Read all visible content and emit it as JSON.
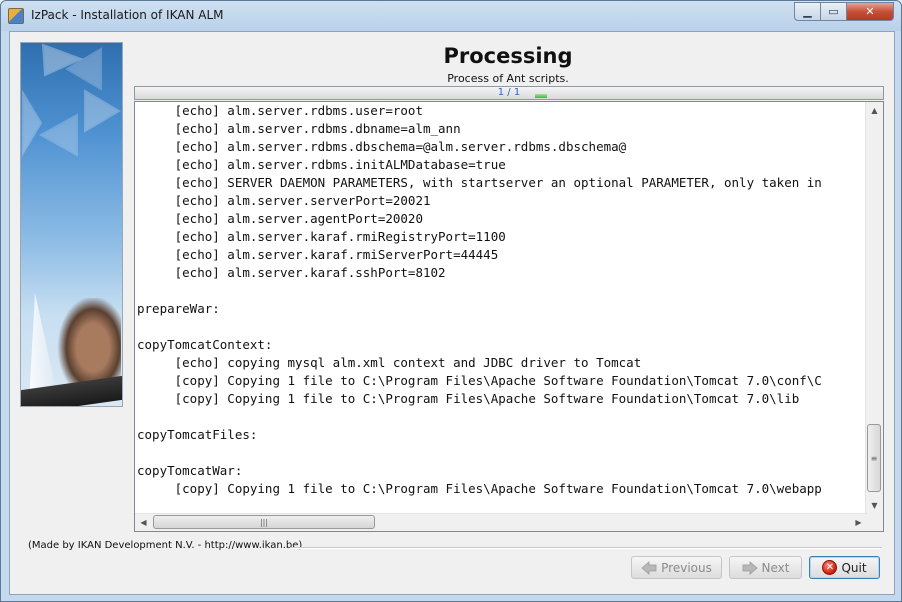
{
  "window": {
    "title": "IzPack - Installation of IKAN ALM",
    "min_glyph": "▁",
    "max_glyph": "▭",
    "close_glyph": "✕"
  },
  "header": {
    "title": "Processing",
    "subtitle": "Process of Ant scripts."
  },
  "progress": {
    "label": "1 / 1",
    "fraction": 1.0
  },
  "log": {
    "lines": [
      "     [echo] alm.server.rdbms.user=root",
      "     [echo] alm.server.rdbms.dbname=alm_ann",
      "     [echo] alm.server.rdbms.dbschema=@alm.server.rdbms.dbschema@",
      "     [echo] alm.server.rdbms.initALMDatabase=true",
      "     [echo] SERVER DAEMON PARAMETERS, with startserver an optional PARAMETER, only taken in",
      "     [echo] alm.server.serverPort=20021",
      "     [echo] alm.server.agentPort=20020",
      "     [echo] alm.server.karaf.rmiRegistryPort=1100",
      "     [echo] alm.server.karaf.rmiServerPort=44445",
      "     [echo] alm.server.karaf.sshPort=8102",
      "",
      "prepareWar:",
      "",
      "copyTomcatContext:",
      "     [echo] copying mysql alm.xml context and JDBC driver to Tomcat",
      "     [copy] Copying 1 file to C:\\Program Files\\Apache Software Foundation\\Tomcat 7.0\\conf\\C",
      "     [copy] Copying 1 file to C:\\Program Files\\Apache Software Foundation\\Tomcat 7.0\\lib",
      "",
      "copyTomcatFiles:",
      "",
      "copyTomcatWar:",
      "     [copy] Copying 1 file to C:\\Program Files\\Apache Software Foundation\\Tomcat 7.0\\webapp"
    ]
  },
  "footer": {
    "made_by": "(Made by IKAN Development N.V. - http://www.ikan.be)",
    "previous_label": "Previous",
    "next_label": "Next",
    "quit_label": "Quit"
  },
  "colors": {
    "progress_label": "#2a66d0",
    "progress_fill": "#3cb83c",
    "quit_icon": "#d11a0a"
  }
}
